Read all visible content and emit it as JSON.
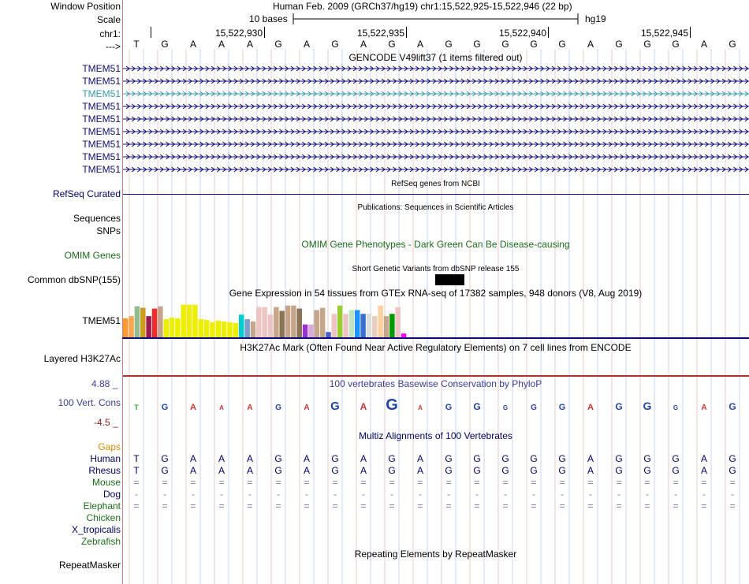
{
  "header": {
    "window_position_label": "Window Position",
    "window_position_value": "Human Feb. 2009 (GRCh37/hg19)   chr1:15,522,925-15,522,946 (22 bp)",
    "scale_label": "Scale",
    "scale_value": "10 bases",
    "scale_assembly": "hg19",
    "chrom_label": "chr1:",
    "coords": [
      "15,522,930",
      "15,522,935",
      "15,522,940",
      "15,522,945"
    ],
    "strand_label": "--->",
    "bases": [
      "T",
      "G",
      "A",
      "A",
      "A",
      "G",
      "A",
      "G",
      "A",
      "G",
      "A",
      "G",
      "G",
      "G",
      "G",
      "G",
      "A",
      "G",
      "G",
      "G",
      "A",
      "G"
    ]
  },
  "tracks": {
    "gencode": {
      "title": "GENCODE V49lift37 (1 items filtered out)",
      "genes": [
        "TMEM51",
        "TMEM51",
        "TMEM51",
        "TMEM51",
        "TMEM51",
        "TMEM51",
        "TMEM51",
        "TMEM51",
        "TMEM51"
      ],
      "highlight_index": 2,
      "color": "#0c0c78",
      "highlight_color": "#3399aa"
    },
    "refseq": {
      "title": "RefSeq genes from NCBI",
      "label": "RefSeq Curated",
      "color": "#0c0c78"
    },
    "publications": {
      "title": "Publications: Sequences in Scientific Articles",
      "label1": "Sequences",
      "label2": "SNPs"
    },
    "omim": {
      "title": "OMIM Gene Phenotypes - Dark Green Can Be Disease-causing",
      "label": "OMIM Genes"
    },
    "dbsnp": {
      "title": "Short Genetic Variants from dbSNP release 155",
      "label": "Common dbSNP(155)"
    },
    "gtex": {
      "title": "Gene Expression in 54 tissues from GTEx RNA-seq of 17382 samples, 948 donors (V8, Aug 2019)",
      "label": "TMEM51",
      "bars": [
        {
          "v": 0.5,
          "c": "#ff9933"
        },
        {
          "v": 0.56,
          "c": "#ffa54f"
        },
        {
          "v": 0.82,
          "c": "#8fbc8f"
        },
        {
          "v": 0.78,
          "c": "#cd9b1d"
        },
        {
          "v": 0.56,
          "c": "#9b1a50"
        },
        {
          "v": 0.76,
          "c": "#ee2c2c"
        },
        {
          "v": 0.82,
          "c": "#c7a58a"
        },
        {
          "v": 0.48,
          "c": "#eeee00"
        },
        {
          "v": 0.52,
          "c": "#eeee00"
        },
        {
          "v": 0.5,
          "c": "#eeee00"
        },
        {
          "v": 0.86,
          "c": "#eeee00"
        },
        {
          "v": 0.86,
          "c": "#eeee00"
        },
        {
          "v": 0.86,
          "c": "#eeee00"
        },
        {
          "v": 0.48,
          "c": "#eeee00"
        },
        {
          "v": 0.46,
          "c": "#eeee00"
        },
        {
          "v": 0.4,
          "c": "#eeee00"
        },
        {
          "v": 0.44,
          "c": "#eeee00"
        },
        {
          "v": 0.42,
          "c": "#eeee00"
        },
        {
          "v": 0.4,
          "c": "#eeee00"
        },
        {
          "v": 0.38,
          "c": "#eeee00"
        },
        {
          "v": 0.6,
          "c": "#00cdcd"
        },
        {
          "v": 0.48,
          "c": "#7a9ec8"
        },
        {
          "v": 0.42,
          "c": "#c7a58a"
        },
        {
          "v": 0.8,
          "c": "#eec4c4"
        },
        {
          "v": 0.8,
          "c": "#eec4c4"
        },
        {
          "v": 0.6,
          "c": "#eec4c4"
        },
        {
          "v": 0.8,
          "c": "#c7a58a"
        },
        {
          "v": 0.7,
          "c": "#8b7355"
        },
        {
          "v": 0.84,
          "c": "#c7a58a"
        },
        {
          "v": 0.84,
          "c": "#c7a58a"
        },
        {
          "v": 0.76,
          "c": "#8b7355"
        },
        {
          "v": 0.34,
          "c": "#9a32cd"
        },
        {
          "v": 0.34,
          "c": "#d8aad8"
        },
        {
          "v": 0.72,
          "c": "#c7a58a"
        },
        {
          "v": 0.78,
          "c": "#c7a58a"
        },
        {
          "v": 0.14,
          "c": "#4b5ecc"
        },
        {
          "v": 0.62,
          "c": "#eec4c4"
        },
        {
          "v": 0.84,
          "c": "#9acd32"
        },
        {
          "v": 0.62,
          "c": "#eec4c4"
        },
        {
          "v": 0.72,
          "c": "#bee6be"
        },
        {
          "v": 0.72,
          "c": "#1e90ff"
        },
        {
          "v": 0.62,
          "c": "#3a70cc"
        },
        {
          "v": 0.62,
          "c": "#dcdcdc"
        },
        {
          "v": 0.56,
          "c": "#e8d0c0"
        },
        {
          "v": 0.84,
          "c": "#fcd0a0"
        },
        {
          "v": 0.56,
          "c": "#c7a58a"
        },
        {
          "v": 0.62,
          "c": "#009900"
        },
        {
          "v": 0.8,
          "c": "#eec4c4"
        },
        {
          "v": 0.1,
          "c": "#ff00ff"
        }
      ]
    },
    "h3k27ac": {
      "title": "H3K27Ac Mark (Often Found Near Active Regulatory Elements) on 7 cell lines from ENCODE",
      "label": "Layered H3K27Ac"
    },
    "phylop": {
      "title": "100 vertebrates Basewise Conservation by PhyloP",
      "label": "100 Vert. Cons",
      "ymax": "4.88 _",
      "ymin": "-4.5 _"
    },
    "multiz": {
      "title": "Multiz Alignments of 100 Vertebrates",
      "gaps_label": "Gaps",
      "species": [
        {
          "name": "Human",
          "cls": "navy",
          "row": [
            "T",
            "G",
            "A",
            "A",
            "A",
            "G",
            "A",
            "G",
            "A",
            "G",
            "A",
            "G",
            "G",
            "G",
            "G",
            "G",
            "A",
            "G",
            "G",
            "G",
            "A",
            "G"
          ]
        },
        {
          "name": "Rhesus",
          "cls": "navy",
          "row": [
            "T",
            "G",
            "A",
            "A",
            "A",
            "G",
            "A",
            "G",
            "A",
            "G",
            "A",
            "G",
            "G",
            "G",
            "G",
            "G",
            "A",
            "G",
            "G",
            "G",
            "A",
            "G"
          ]
        },
        {
          "name": "Mouse",
          "cls": "green",
          "row": [
            "=",
            "=",
            "=",
            "=",
            "=",
            "=",
            "=",
            "=",
            "=",
            "=",
            "=",
            "=",
            "=",
            "=",
            "=",
            "=",
            "=",
            "=",
            "=",
            "=",
            "=",
            "="
          ]
        },
        {
          "name": "Dog",
          "cls": "navy",
          "row": [
            "-",
            "-",
            "-",
            "-",
            "-",
            "-",
            "-",
            "-",
            "-",
            "-",
            "-",
            "-",
            "-",
            "-",
            "-",
            "-",
            "-",
            "-",
            "-",
            "-",
            "-",
            "-"
          ]
        },
        {
          "name": "Elephant",
          "cls": "green",
          "row": [
            "=",
            "=",
            "=",
            "=",
            "=",
            "=",
            "=",
            "=",
            "=",
            "=",
            "=",
            "=",
            "=",
            "=",
            "=",
            "=",
            "=",
            "=",
            "=",
            "=",
            "=",
            "="
          ]
        },
        {
          "name": "Chicken",
          "cls": "green",
          "row": []
        },
        {
          "name": "X_tropicalis",
          "cls": "navy",
          "row": []
        },
        {
          "name": "Zebrafish",
          "cls": "green",
          "row": []
        }
      ]
    },
    "repeatmasker": {
      "title": "Repeating Elements by RepeatMasker",
      "label": "RepeatMasker"
    }
  }
}
